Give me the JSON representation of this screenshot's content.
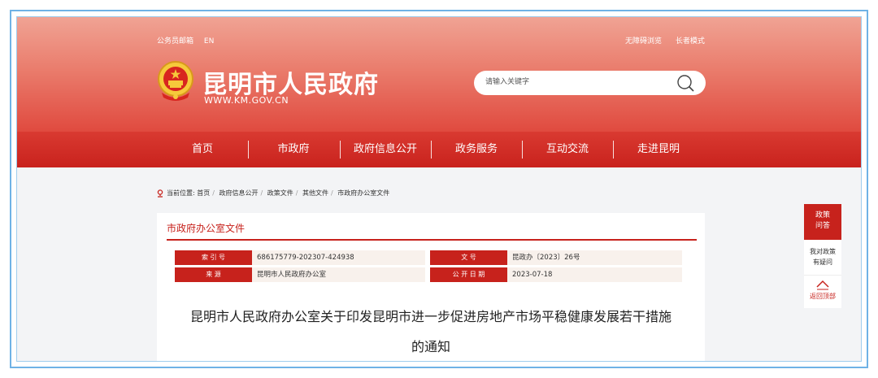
{
  "topbar": {
    "left_links": [
      "公务员邮箱",
      "EN"
    ],
    "right_links": [
      "无障碍浏览",
      "长者模式"
    ]
  },
  "site": {
    "name": "昆明市人民政府",
    "url": "WWW.KM.GOV.CN"
  },
  "search": {
    "placeholder": "请输入关键字"
  },
  "nav": {
    "items": [
      "首页",
      "市政府",
      "政府信息公开",
      "政务服务",
      "互动交流",
      "走进昆明"
    ]
  },
  "breadcrumb": {
    "prefix": "当前位置:",
    "items": [
      "首页",
      "政府信息公开",
      "政策文件",
      "其他文件",
      "市政府办公室文件"
    ]
  },
  "panel": {
    "title": "市政府办公室文件"
  },
  "meta": {
    "index_label": "索 引 号",
    "index_value": "686175779-202307-424938",
    "doc_no_label": "文 号",
    "doc_no_value": "昆政办〔2023〕26号",
    "source_label": "来 源",
    "source_value": "昆明市人民政府办公室",
    "date_label": "公 开 日 期",
    "date_value": "2023-07-18"
  },
  "document": {
    "title_line1": "昆明市人民政府办公室关于印发昆明市进一步促进房地产市场平稳健康发展若干措施",
    "title_line2": "的通知"
  },
  "side": {
    "policy_qa_line1": "政策",
    "policy_qa_line2": "问答",
    "ask_line1": "我对政策",
    "ask_line2": "有疑问",
    "back_to_top": "返回顶部"
  },
  "colors": {
    "brand_red": "#c7221c",
    "header_gradient_top": "#f0a394",
    "header_gradient_bottom": "#e04a3f",
    "frame_blue": "#6fb2e6"
  }
}
